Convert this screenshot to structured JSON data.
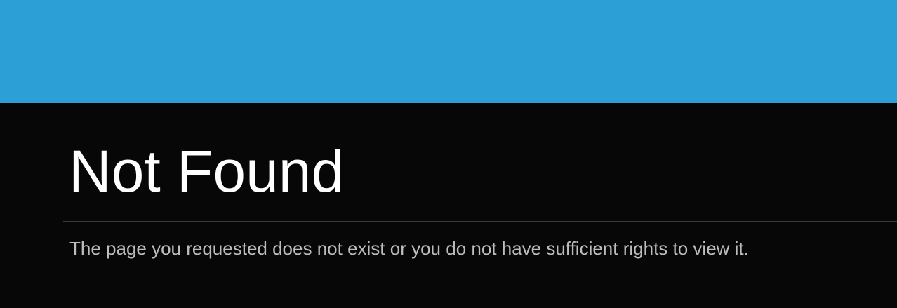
{
  "header": {
    "banner_color": "#2b9fd6"
  },
  "main": {
    "title": "Not Found",
    "message": "The page you requested does not exist or you do not have sufficient rights to view it."
  },
  "colors": {
    "background": "#070707",
    "title_text": "#ffffff",
    "message_text": "#bdbdbd",
    "divider": "#3a3a3a"
  }
}
